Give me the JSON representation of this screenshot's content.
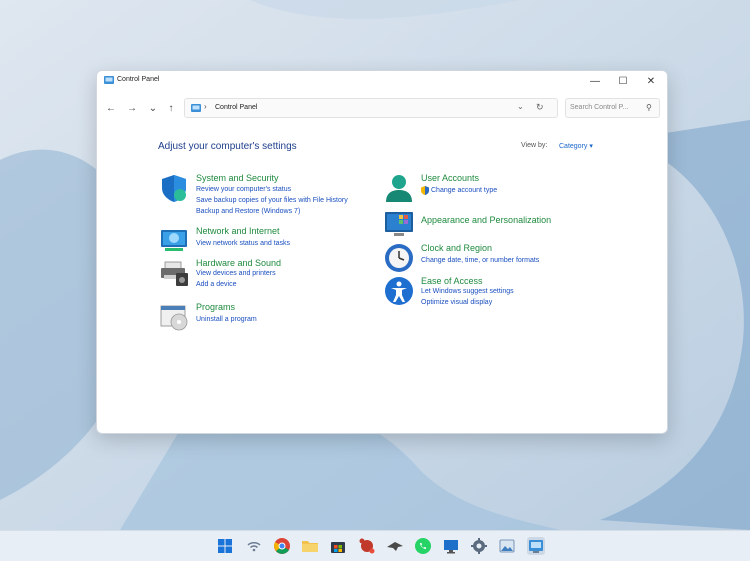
{
  "window": {
    "title": "Control Panel",
    "controls": {
      "minimize": "—",
      "maximize": "☐",
      "close": "✕"
    }
  },
  "navbar": {
    "back": "←",
    "forward": "→",
    "recent": "⌄",
    "up": "↑",
    "address_separator": "›",
    "address": "Control Panel",
    "address_dropdown": "⌄",
    "refresh": "↻",
    "search_placeholder": "Search Control P...",
    "search_icon": "⚲"
  },
  "content": {
    "heading": "Adjust your computer's settings",
    "view_by_label": "View by:",
    "view_by_value": "Category ▾",
    "left_column": [
      {
        "icon": "shield-icon",
        "title": "System and Security",
        "links": [
          "Review your computer's status",
          "Save backup copies of your files with File History",
          "Backup and Restore (Windows 7)"
        ]
      },
      {
        "icon": "network-icon",
        "title": "Network and Internet",
        "links": [
          "View network status and tasks"
        ]
      },
      {
        "icon": "printer-icon",
        "title": "Hardware and Sound",
        "links": [
          "View devices and printers",
          "Add a device"
        ]
      },
      {
        "icon": "programs-icon",
        "title": "Programs",
        "links": [
          "Uninstall a program"
        ]
      }
    ],
    "right_column": [
      {
        "icon": "user-icon",
        "title": "User Accounts",
        "links": [
          "Change account type"
        ]
      },
      {
        "icon": "appearance-icon",
        "title": "Appearance and Personalization",
        "links": []
      },
      {
        "icon": "clock-icon",
        "title": "Clock and Region",
        "links": [
          "Change date, time, or number formats"
        ]
      },
      {
        "icon": "accessibility-icon",
        "title": "Ease of Access",
        "links": [
          "Let Windows suggest settings",
          "Optimize visual display"
        ]
      }
    ]
  },
  "colors": {
    "heading": "#1e3e8c",
    "category_title": "#1f8a3f",
    "link": "#1a4fbf"
  },
  "taskbar": {
    "icons": [
      "windows-start-icon",
      "wifi-icon",
      "chrome-icon",
      "file-explorer-icon",
      "store-icon",
      "puzzle-app-icon",
      "hawk-app-icon",
      "whatsapp-icon",
      "remote-desktop-icon",
      "settings-gear-icon",
      "photos-icon",
      "control-panel-icon"
    ]
  }
}
